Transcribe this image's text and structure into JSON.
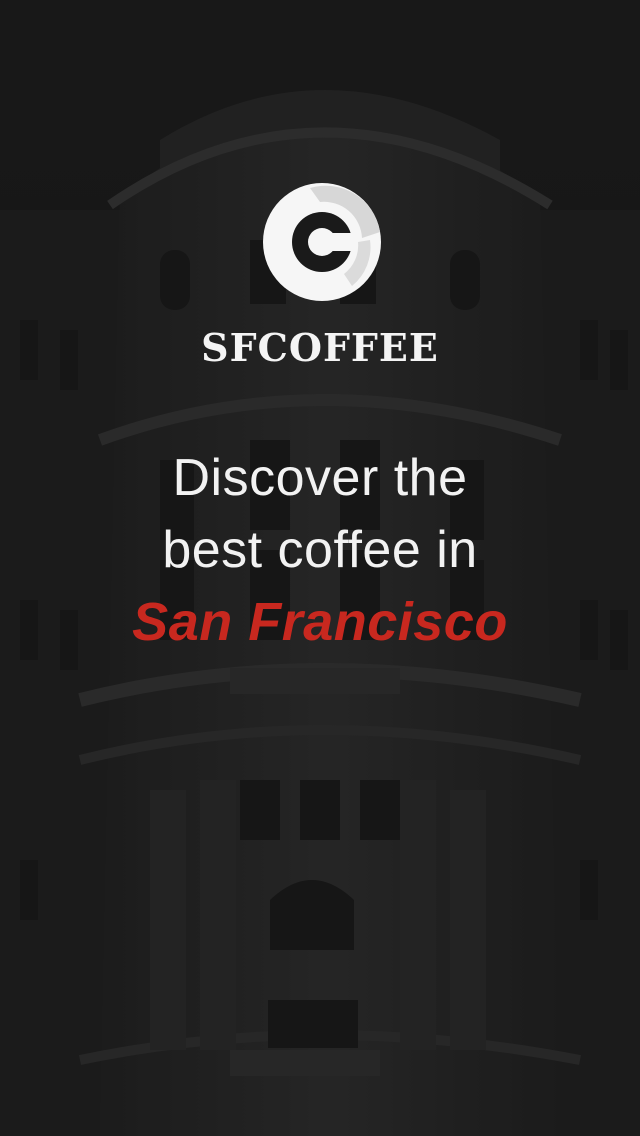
{
  "brand": {
    "name": "SFCOFFEE",
    "logo_icon": "coffee-c-logo-icon"
  },
  "tagline": {
    "line1": "Discover the",
    "line2": "best coffee in",
    "city": "San Francisco"
  },
  "background": {
    "subject": "building-photo",
    "tone": "#222222"
  },
  "colors": {
    "accent": "#c8281f",
    "text": "#f2f2f2"
  }
}
